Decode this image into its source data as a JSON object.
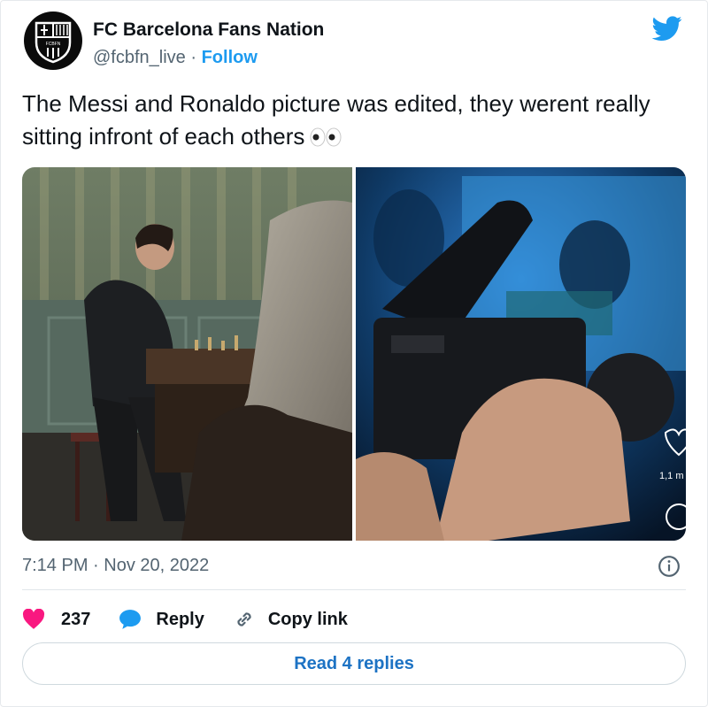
{
  "author": {
    "display_name": "FC Barcelona Fans Nation",
    "handle": "@fcbfn_live",
    "separator": "·",
    "follow_label": "Follow",
    "avatar_text": "FCBFN"
  },
  "tweet": {
    "text": "The Messi and Ronaldo picture was edited, they werent really sitting infront of each others"
  },
  "media": {
    "image_count": 2,
    "side_overlay_count": "1,1 m"
  },
  "meta": {
    "timestamp": "7:14 PM · Nov 20, 2022"
  },
  "actions": {
    "likes_count": "237",
    "reply_label": "Reply",
    "copy_link_label": "Copy link",
    "read_replies_label": "Read 4 replies"
  },
  "colors": {
    "twitter_blue": "#1d9bf0",
    "heart_red": "#f91880",
    "text_primary": "#0f1419",
    "text_secondary": "#536471"
  },
  "icons": [
    "twitter-bird-icon",
    "info-icon",
    "heart-icon",
    "reply-bubble-icon",
    "link-icon"
  ]
}
